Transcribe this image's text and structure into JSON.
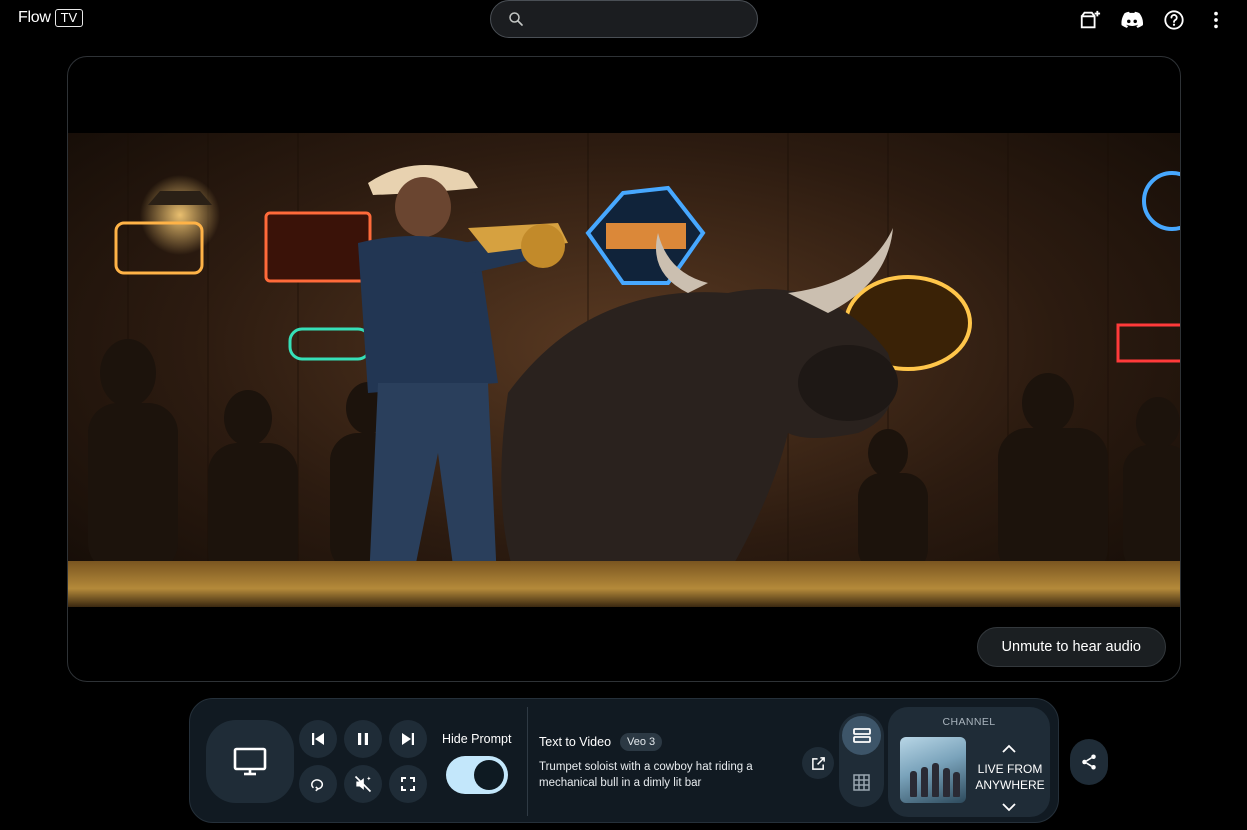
{
  "header": {
    "logo_word": "Flow",
    "logo_badge": "TV",
    "search_placeholder": "",
    "icons": [
      "add-to-collection-icon",
      "discord-icon",
      "help-icon",
      "more-vert-icon"
    ]
  },
  "player": {
    "unmute_label": "Unmute to hear audio"
  },
  "controls": {
    "hide_prompt_label": "Hide Prompt",
    "hide_prompt_on": true,
    "mode": "Text to Video",
    "model_badge": "Veo 3",
    "prompt": "Trumpet soloist with a cowboy hat riding a mechanical bull in a dimly lit bar",
    "icons": [
      "tv-icon",
      "skip-previous-icon",
      "pause-icon",
      "skip-next-icon",
      "loop-icon",
      "muted-icon",
      "fullscreen-icon",
      "open-in-new-icon",
      "list-view-icon",
      "grid-view-icon",
      "share-icon"
    ]
  },
  "channel": {
    "label": "CHANNEL",
    "name": "LIVE FROM ANYWHERE"
  },
  "colors": {
    "background": "#000000",
    "panel": "#111a22",
    "button": "#1f2c37",
    "toggle_on": "#c3e7fb",
    "active_view": "#3d5569"
  }
}
